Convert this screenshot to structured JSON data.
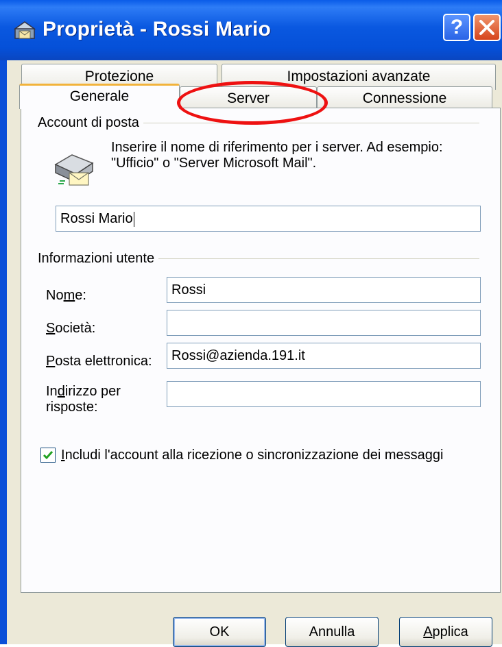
{
  "window": {
    "title": "Proprietà - Rossi Mario",
    "icon": "mailbox-account-icon",
    "help_label": "?",
    "close_icon": "close-icon"
  },
  "tabs": {
    "row_back": [
      {
        "label": "Protezione"
      },
      {
        "label": "Impostazioni avanzate"
      }
    ],
    "row_front": [
      {
        "label": "Generale",
        "active": true
      },
      {
        "label": "Server",
        "active": false
      },
      {
        "label": "Connessione",
        "active": false
      }
    ]
  },
  "mail_account": {
    "group_label": "Account di posta",
    "description": "Inserire il nome di riferimento per i server. Ad esempio: \"Ufficio\" o \"Server Microsoft Mail\".",
    "account_name": "Rossi Mario"
  },
  "user_info": {
    "group_label": "Informazioni utente",
    "name_label": "Nome:",
    "name_value": "Rossi",
    "company_label": "Società:",
    "company_value": "",
    "email_label": "Posta elettronica:",
    "email_value": "Rossi@azienda.191.it",
    "reply_label": "Indirizzo per risposte:",
    "reply_value": ""
  },
  "include_account": {
    "checked": true,
    "label": "Includi l'account alla ricezione o sincronizzazione dei messaggi"
  },
  "buttons": {
    "ok": "OK",
    "cancel": "Annulla",
    "apply": "Applica"
  },
  "colors": {
    "titlebar": "#0a58e0",
    "annotation": "#ee1111",
    "active_tab_accent": "#f2b33b"
  }
}
